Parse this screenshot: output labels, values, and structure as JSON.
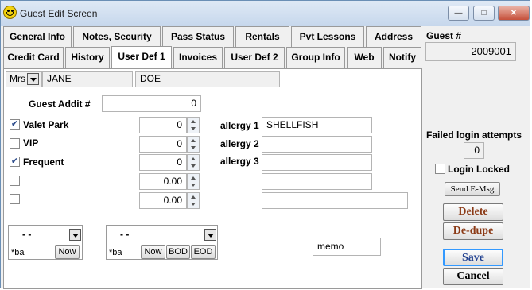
{
  "window": {
    "title": "Guest Edit Screen",
    "minimize": "—",
    "maximize": "□",
    "close": "✕"
  },
  "tabs_row1": [
    "General Info",
    "Notes, Security",
    "Pass Status",
    "Rentals",
    "Pvt Lessons",
    "Address"
  ],
  "tabs_row2": [
    "Credit Card",
    "History",
    "User Def 1",
    "Invoices",
    "User Def 2",
    "Group Info",
    "Web",
    "Notify"
  ],
  "active_tab": "User Def 1",
  "name": {
    "salutation": "Mrs",
    "first": "JANE",
    "last": "DOE"
  },
  "guest_addit": {
    "label": "Guest Addit #",
    "value": "0"
  },
  "rows": [
    {
      "label": "Valet Park",
      "checked": true,
      "value": "0"
    },
    {
      "label": "VIP",
      "checked": false,
      "value": "0"
    },
    {
      "label": "Frequent",
      "checked": true,
      "value": "0"
    },
    {
      "label": "",
      "checked": false,
      "value": "0.00"
    },
    {
      "label": "",
      "checked": false,
      "value": "0.00"
    }
  ],
  "allergies": [
    {
      "label": "allergy 1",
      "value": "SHELLFISH"
    },
    {
      "label": "allergy 2",
      "value": ""
    },
    {
      "label": "allergy 3",
      "value": ""
    }
  ],
  "date_boxes": [
    {
      "value": "- -",
      "text": "*ba",
      "buttons": [
        "Now"
      ]
    },
    {
      "value": "- -",
      "text": "*ba",
      "buttons": [
        "Now",
        "BOD",
        "EOD"
      ]
    }
  ],
  "memo": "memo",
  "sidebar": {
    "guest_label": "Guest #",
    "guest_number": "2009001",
    "failed_label": "Failed login attempts",
    "failed_value": "0",
    "login_locked_label": "Login Locked",
    "send_email": "Send E-Msg",
    "delete": "Delete",
    "dedupe": "De-dupe",
    "save": "Save",
    "cancel": "Cancel"
  },
  "colors": {
    "brown_button_text": "#8b3a16",
    "save_text": "#1f3f8f",
    "active_border": "#3399ff"
  }
}
